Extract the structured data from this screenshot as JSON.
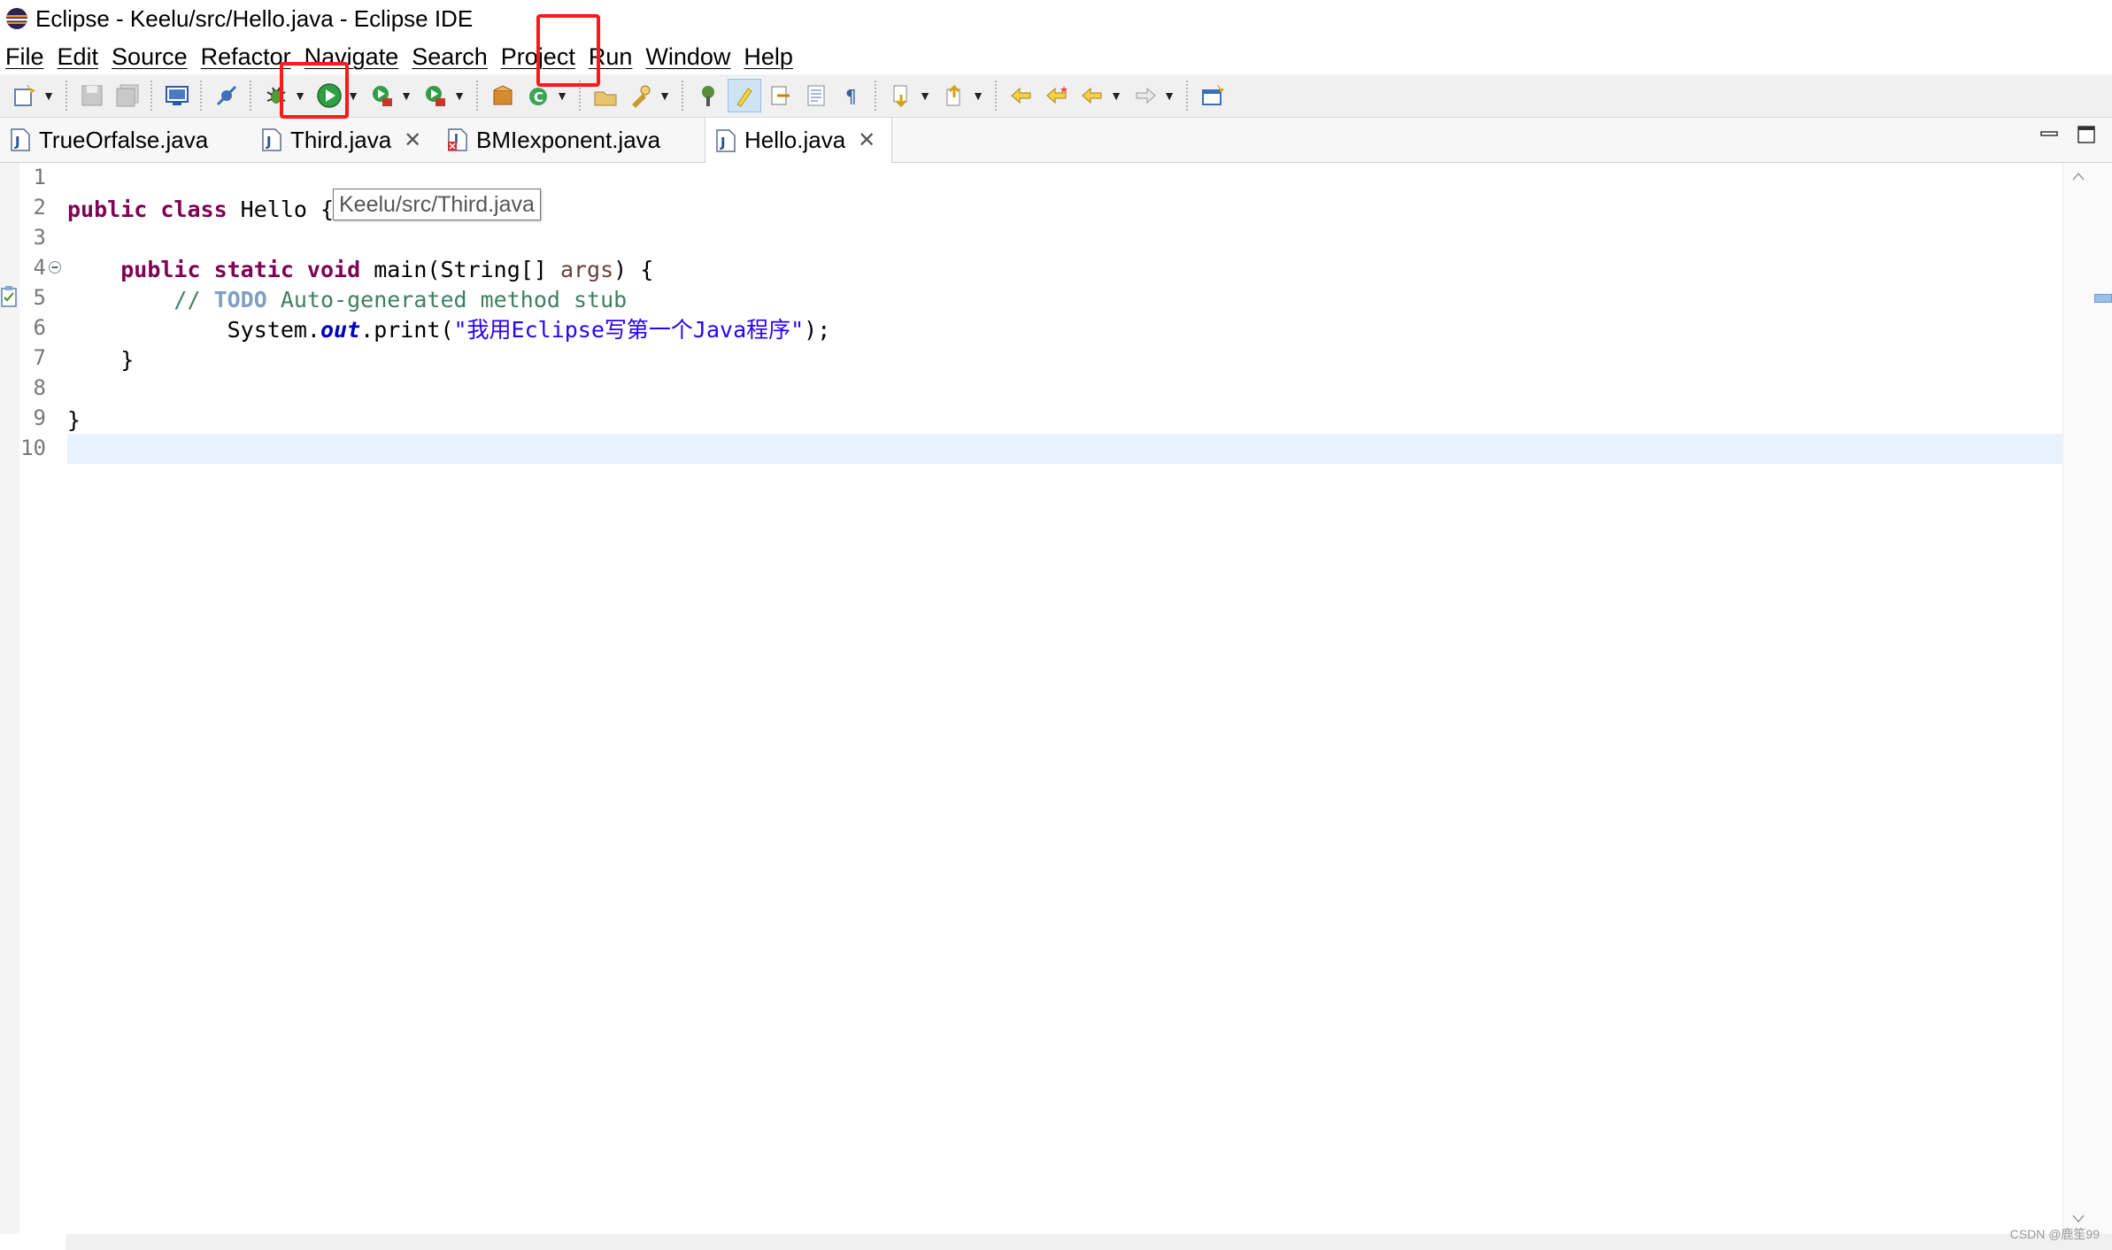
{
  "window": {
    "title": "Eclipse - Keelu/src/Hello.java - Eclipse IDE"
  },
  "menu": [
    "File",
    "Edit",
    "Source",
    "Refactor",
    "Navigate",
    "Search",
    "Project",
    "Run",
    "Window",
    "Help"
  ],
  "tabs": [
    {
      "label": "TrueOrfalse.java",
      "active": false,
      "error": false
    },
    {
      "label": "Third.java",
      "active": false,
      "error": false,
      "close": "✕"
    },
    {
      "label": "BMIexponent.java",
      "active": false,
      "error": true
    },
    {
      "label": "Hello.java",
      "active": true,
      "error": false,
      "close": "✕"
    }
  ],
  "editor": {
    "line_numbers": [
      "1",
      "2",
      "3",
      "4",
      "5",
      "6",
      "7",
      "8",
      "9",
      "10"
    ],
    "code": {
      "l2_kw": "public class",
      "l2_rest": " Hello {",
      "l4_kw": "public static void",
      "l4_mid": " main(String[] ",
      "l4_param": "args",
      "l4_end": ") {",
      "l5_comment": "// ",
      "l5_todo": "TODO",
      "l5_rest": " Auto-generated method stub",
      "l6_pre": "System.",
      "l6_field": "out",
      "l6_mid": ".print(",
      "l6_str": "\"我用Eclipse写第一个Java程序\"",
      "l6_end": ");",
      "l7": "}",
      "l9": "}"
    },
    "tooltip": "Keelu/src/Third.java"
  },
  "watermark": "CSDN @鹿笙99"
}
